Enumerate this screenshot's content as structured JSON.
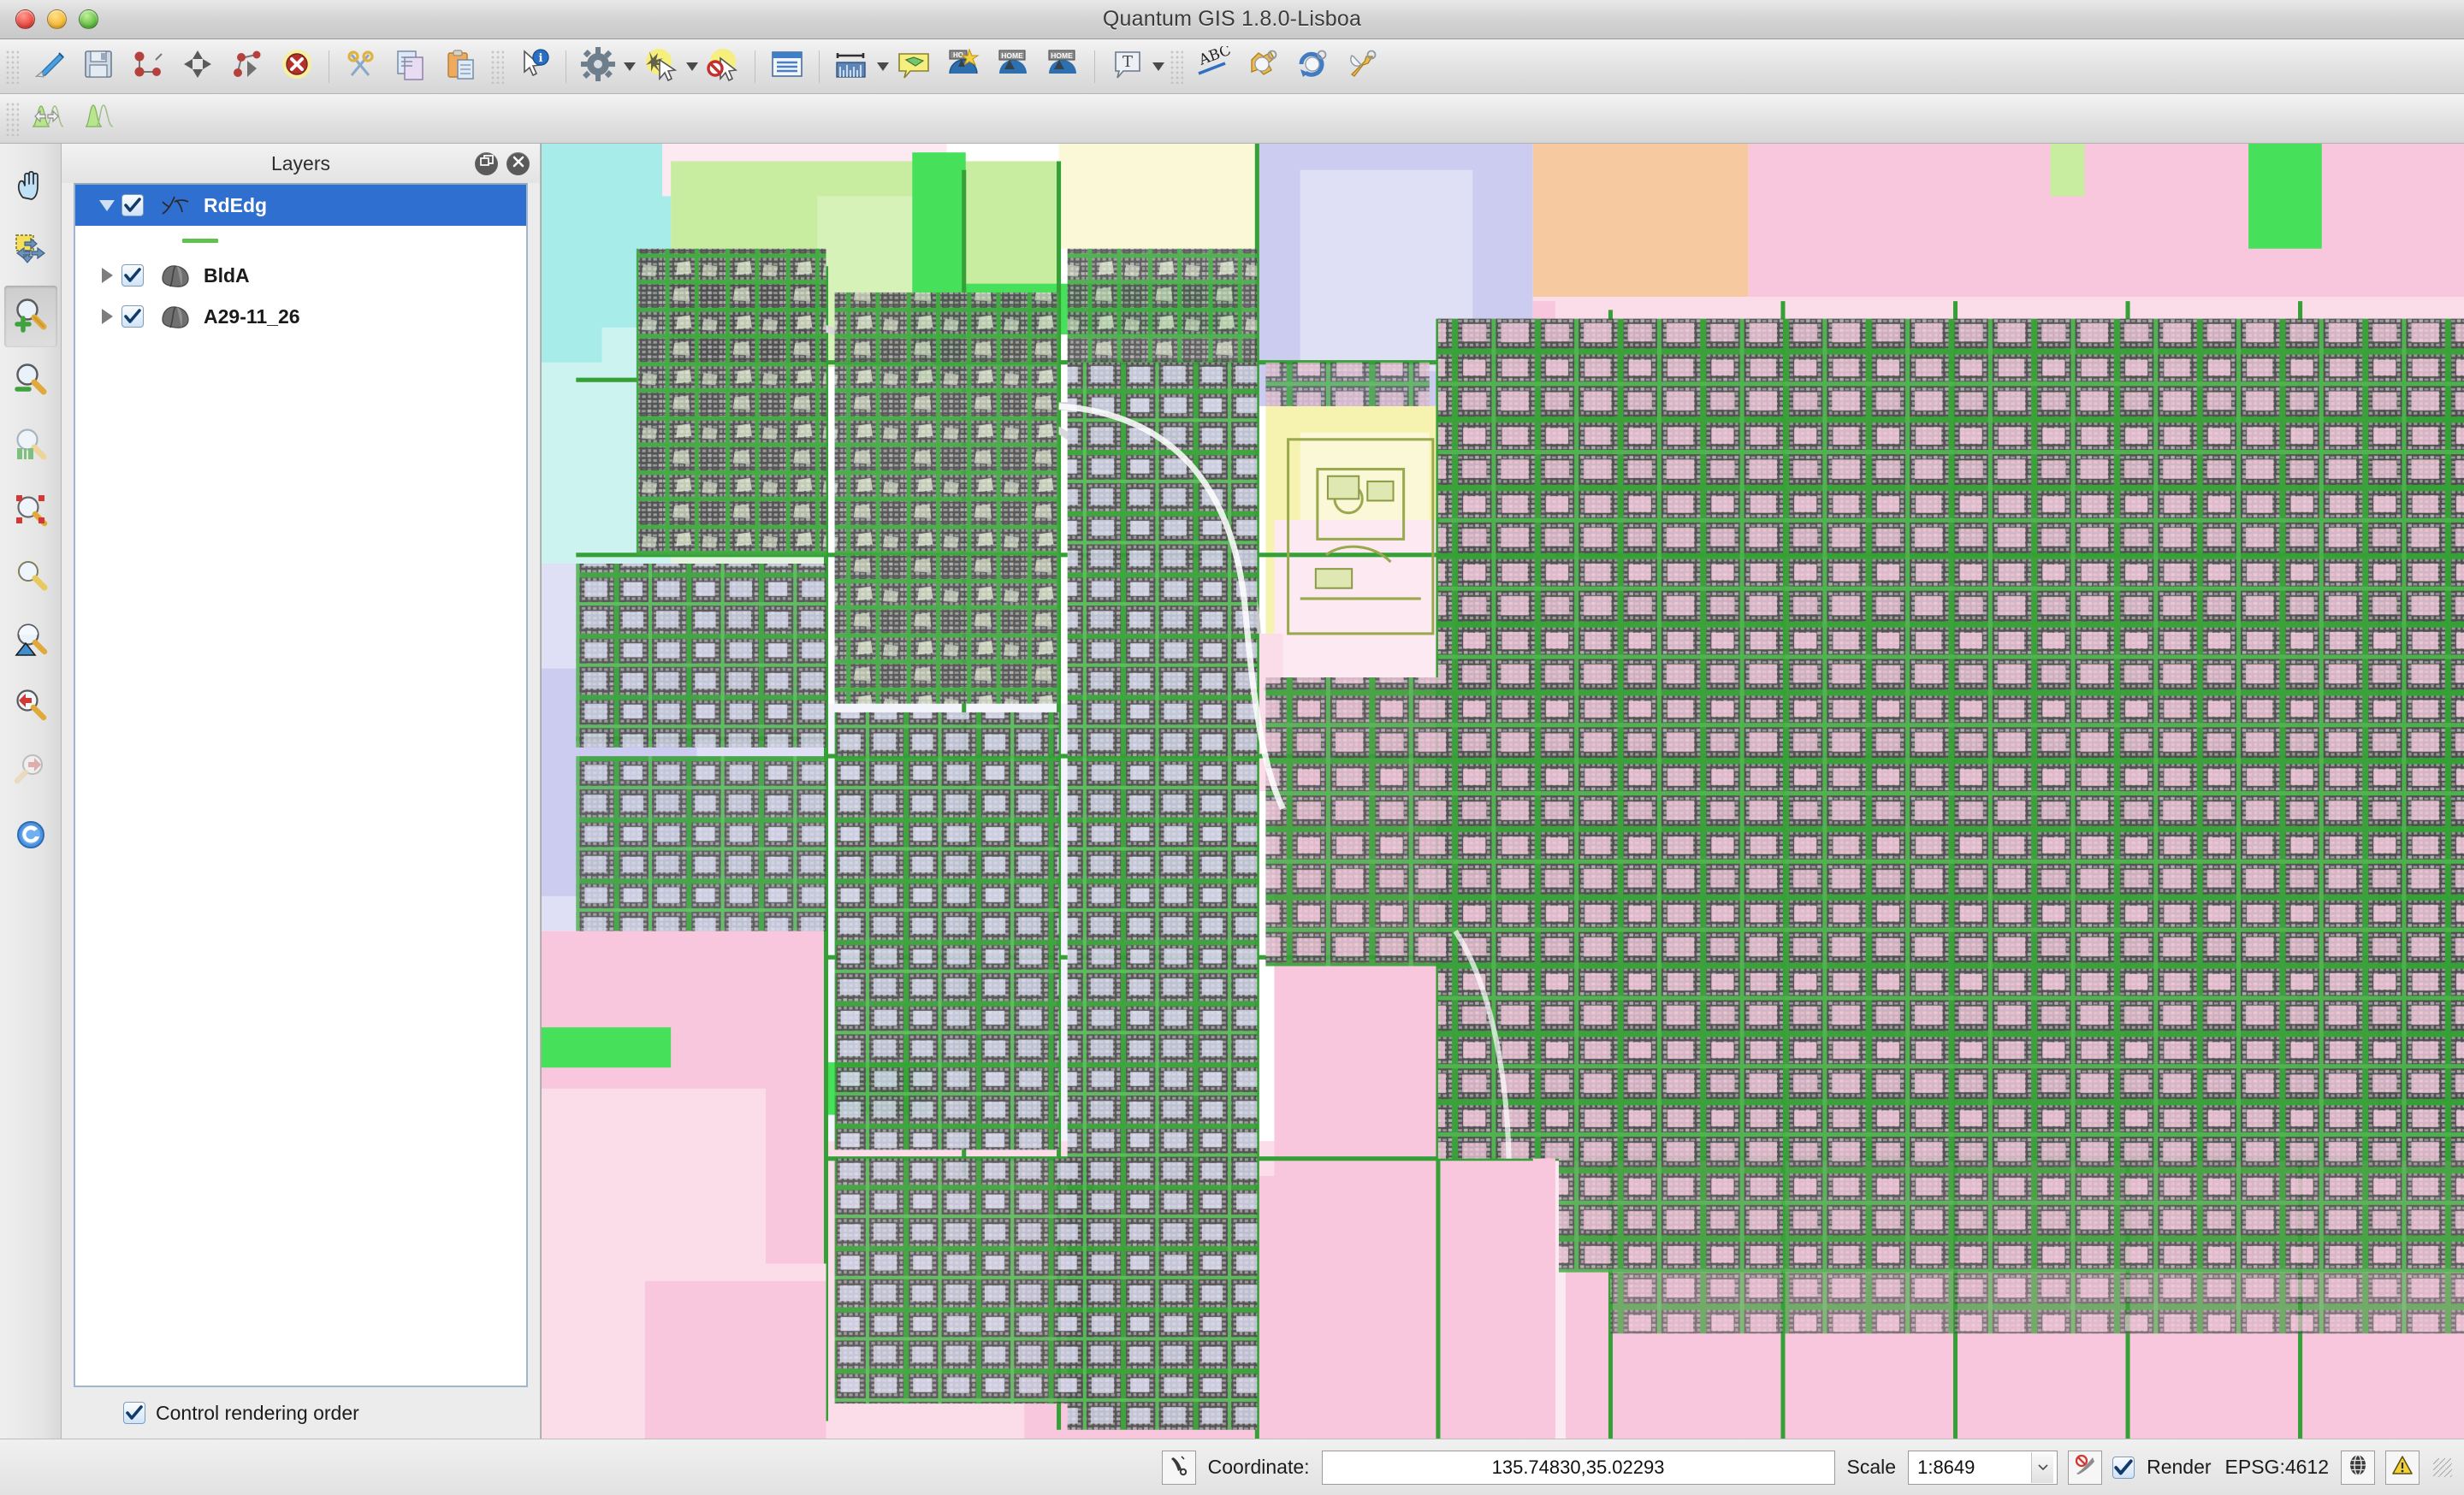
{
  "window": {
    "title": "Quantum GIS 1.8.0-Lisboa",
    "controls": {
      "close": "close",
      "minimize": "minimize",
      "zoom": "zoom"
    }
  },
  "toolbar_main": {
    "items": [
      {
        "name": "toggle-editing",
        "icon": "pencil-icon",
        "label": "Toggle editing"
      },
      {
        "name": "save-edits",
        "icon": "save-icon",
        "label": "Save edits"
      },
      {
        "name": "add-feature",
        "icon": "add-feature-icon",
        "label": "Add Feature"
      },
      {
        "name": "move-feature",
        "icon": "move-feature-icon",
        "label": "Move Feature"
      },
      {
        "name": "node-tool",
        "icon": "node-tool-icon",
        "label": "Node Tool"
      },
      {
        "name": "delete-selected",
        "icon": "delete-icon",
        "label": "Delete Selected"
      },
      {
        "name": "cut-features",
        "icon": "scissors-icon",
        "label": "Cut Features"
      },
      {
        "name": "copy-features",
        "icon": "copy-icon",
        "label": "Copy Features"
      },
      {
        "name": "paste-features",
        "icon": "paste-icon",
        "label": "Paste Features"
      },
      {
        "name": "identify-features",
        "icon": "identify-icon",
        "label": "Identify Features"
      },
      {
        "name": "map-settings",
        "icon": "gear-icon",
        "label": "Settings",
        "has_dropdown": true
      },
      {
        "name": "select-features",
        "icon": "select-icon",
        "label": "Select Features",
        "has_dropdown": true
      },
      {
        "name": "deselect-features",
        "icon": "deselect-icon",
        "label": "Deselect Features"
      },
      {
        "name": "open-attribute-table",
        "icon": "attribute-table-icon",
        "label": "Open Attribute Table"
      },
      {
        "name": "measure-line",
        "icon": "measure-icon",
        "label": "Measure Line",
        "has_dropdown": true
      },
      {
        "name": "map-tips",
        "icon": "map-tips-icon",
        "label": "Map Tips"
      },
      {
        "name": "new-bookmark",
        "icon": "new-bookmark-icon",
        "label": "New Bookmark"
      },
      {
        "name": "show-bookmarks",
        "icon": "show-bookmarks-icon",
        "label": "Show Bookmarks"
      },
      {
        "name": "home-bookmark",
        "icon": "home-bookmark-icon",
        "label": "Home Bookmark"
      },
      {
        "name": "text-annotation",
        "icon": "text-annotation-icon",
        "label": "Text Annotation",
        "has_dropdown": true
      },
      {
        "name": "label-tool",
        "icon": "abc-label-icon",
        "label": "Labeling"
      },
      {
        "name": "plugin-manager",
        "icon": "plugin-icon",
        "label": "Plugin Manager"
      },
      {
        "name": "plugin-refresh",
        "icon": "plugin-refresh-icon",
        "label": "Refresh Plugin"
      },
      {
        "name": "plugin-settings",
        "icon": "plugin-wrench-icon",
        "label": "Plugin Settings"
      }
    ]
  },
  "toolbar_secondary": {
    "items": [
      {
        "name": "histogram-stretch-both",
        "icon": "histogram-stretch-icon",
        "label": "Stretch Histogram"
      },
      {
        "name": "histogram-single",
        "icon": "histogram-icon",
        "label": "Histogram"
      }
    ]
  },
  "map_tools": {
    "items": [
      {
        "name": "pan-map",
        "icon": "hand-icon",
        "label": "Pan Map",
        "active": false
      },
      {
        "name": "pan-to-selection",
        "icon": "pan-selection-icon",
        "label": "Pan Map to Selection",
        "active": false
      },
      {
        "name": "zoom-in",
        "icon": "zoom-in-icon",
        "label": "Zoom In",
        "active": true
      },
      {
        "name": "zoom-out",
        "icon": "zoom-out-icon",
        "label": "Zoom Out",
        "active": false
      },
      {
        "name": "zoom-full",
        "icon": "zoom-full-icon",
        "label": "Zoom Full",
        "active": false
      },
      {
        "name": "zoom-to-selection",
        "icon": "zoom-selection-icon",
        "label": "Zoom To Selection",
        "active": false
      },
      {
        "name": "zoom-to-layer",
        "icon": "zoom-layer-icon",
        "label": "Zoom To Layer",
        "active": false
      },
      {
        "name": "zoom-to-native",
        "icon": "zoom-native-icon",
        "label": "Zoom To Native Resolution",
        "active": false
      },
      {
        "name": "zoom-last",
        "icon": "zoom-last-icon",
        "label": "Zoom Last",
        "active": false
      },
      {
        "name": "zoom-next",
        "icon": "zoom-next-icon",
        "label": "Zoom Next",
        "active": false,
        "disabled": true
      },
      {
        "name": "refresh-map",
        "icon": "refresh-icon",
        "label": "Refresh",
        "active": false
      }
    ]
  },
  "layers_panel": {
    "title": "Layers",
    "float_button": "undock-icon",
    "close_button": "close-icon",
    "layers": [
      {
        "name": "RdEdg",
        "checked": true,
        "selected": true,
        "expanded": true,
        "symbol": "line-symbol",
        "legend": "green-line"
      },
      {
        "name": "BldA",
        "checked": true,
        "selected": false,
        "expanded": false,
        "symbol": "polygon-symbol"
      },
      {
        "name": "A29-11_26",
        "checked": true,
        "selected": false,
        "expanded": false,
        "symbol": "polygon-symbol"
      }
    ],
    "control_rendering_order": {
      "label": "Control rendering order",
      "checked": true
    }
  },
  "status_bar": {
    "coordinate_icon": "coordinate-toggle-icon",
    "coordinate_label": "Coordinate:",
    "coordinate_value": "135.74830,35.02293",
    "scale_label": "Scale",
    "scale_value": "1:8649",
    "stop_render_icon": "stop-render-icon",
    "render_checked": true,
    "render_label": "Render",
    "crs_label": "EPSG:4612",
    "crs_icon": "globe-icon",
    "messages_icon": "warning-icon"
  },
  "map_canvas": {
    "crs": "EPSG:4612",
    "scale": "1:8649",
    "center": "135.74830,35.02293",
    "colors": {
      "pink_zone": "#f9c7dd",
      "light_pink_zone": "#fbdce9",
      "pale_pink": "#fce9f2",
      "yellow_zone": "#f6f2b0",
      "pale_yellow": "#faf8d6",
      "green_zone": "#c8eda0",
      "bright_green": "#46e05a",
      "lavender_zone": "#ccccf0",
      "pale_lavender": "#dfdff5",
      "cyan_zone": "#a8ecea",
      "pale_cyan": "#cdf3f1",
      "orange_zone": "#f7c9a0",
      "road_edge": "#35a035",
      "building": "#4d4d4d",
      "canvas_bg": "#ffffff"
    }
  }
}
